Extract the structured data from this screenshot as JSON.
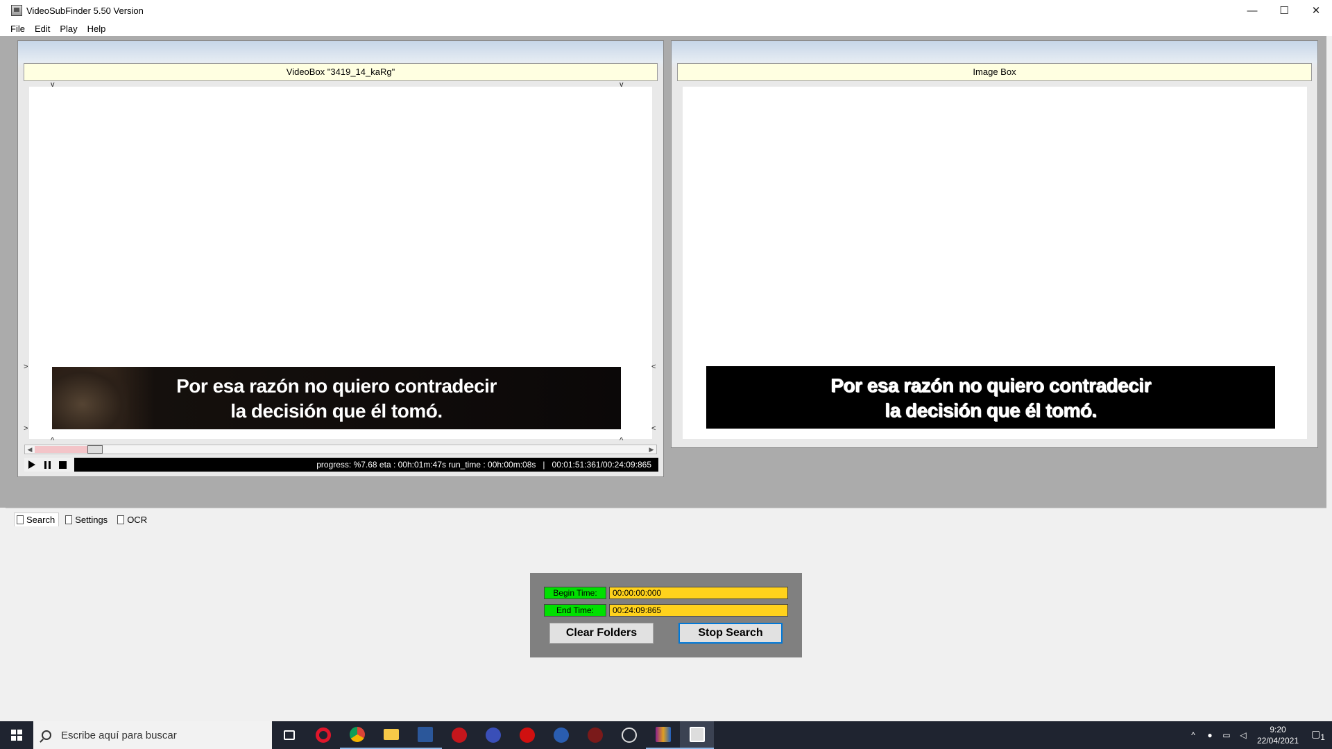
{
  "window": {
    "title": "VideoSubFinder 5.50 Version",
    "controls": [
      "—",
      "☐",
      "✕"
    ]
  },
  "menu": [
    "File",
    "Edit",
    "Play",
    "Help"
  ],
  "video_box": {
    "header": "VideoBox \"3419_14_kaRg\"",
    "subtitle_lines": [
      "Por esa razón no quiero contradecir",
      "la decisión que él tomó."
    ],
    "progress_text": "progress: %7.68 eta : 00h:01m:47s run_time : 00h:00m:08s   |   00:01:51:361/00:24:09:865",
    "progress_percent": 7.68
  },
  "image_box": {
    "header": "Image Box",
    "subtitle_lines": [
      "Por esa razón no quiero contradecir",
      "la decisión que él tomó."
    ]
  },
  "tabs": [
    "Search",
    "Settings",
    "OCR"
  ],
  "search_panel": {
    "begin_label": "Begin Time:",
    "begin_value": "00:00:00:000",
    "end_label": "End Time:",
    "end_value": "00:24:09:865",
    "clear_button": "Clear Folders",
    "stop_button": "Stop Search"
  },
  "taskbar": {
    "search_placeholder": "Escribe aquí para buscar",
    "apps": [
      "task-view",
      "opera",
      "chrome",
      "file-explorer",
      "word",
      "app-red",
      "app-blue",
      "app-pen",
      "app-blue2",
      "app-davinci",
      "app-obs",
      "app-winrar",
      "videosubfinder"
    ],
    "time": "9:20",
    "date": "22/04/2021",
    "notifications": "1"
  },
  "colors": {
    "label_green": "#00e000",
    "value_yellow": "#ffd21c",
    "workspace_gray": "#ababab",
    "header_yellow": "#ffffe1"
  }
}
